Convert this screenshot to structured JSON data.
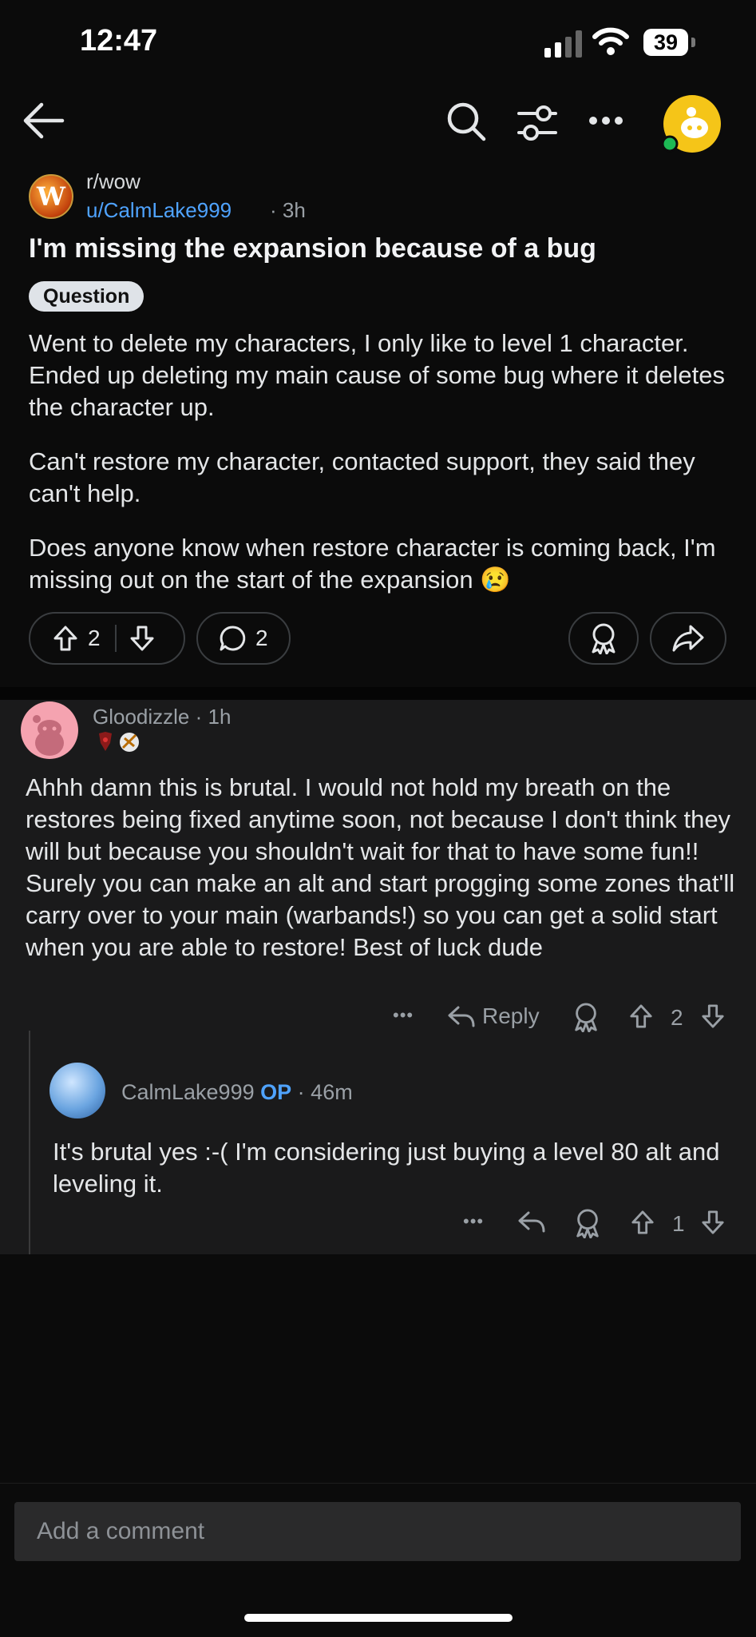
{
  "status_bar": {
    "time": "12:47",
    "battery": "39"
  },
  "post": {
    "subreddit": "r/wow",
    "author": "u/CalmLake999",
    "age": "3h",
    "title": "I'm missing the expansion because of a bug",
    "flair": "Question",
    "paragraphs": [
      "Went to delete my characters, I only like to level 1 character. Ended up deleting my main cause of some bug where it deletes the character up.",
      "Can't restore my character, contacted support, they said they can't help.",
      "Does anyone know when restore character is coming back, I'm missing out on the start of the expansion"
    ],
    "emoji": "😢",
    "votes": "2",
    "comments": "2"
  },
  "comments": [
    {
      "author": "Gloodizzle",
      "age": "1h",
      "body": "Ahhh damn this is brutal. I would not hold my breath on the restores being fixed anytime soon, not because I don't think they will but because you shouldn't wait for that to have some fun!! Surely you can make an alt and start progging some zones that'll carry over to your main (warbands!) so you can get a solid start when you are able to restore! Best of luck dude",
      "reply_label": "Reply",
      "votes": "2"
    },
    {
      "author": "CalmLake999",
      "op_label": "OP",
      "age": "46m",
      "body": "It's brutal yes :-( I'm considering just buying a level 80 alt and leveling it.",
      "votes": "1"
    }
  ],
  "composer": {
    "placeholder": "Add a comment"
  },
  "separator": "·",
  "more": "•••"
}
